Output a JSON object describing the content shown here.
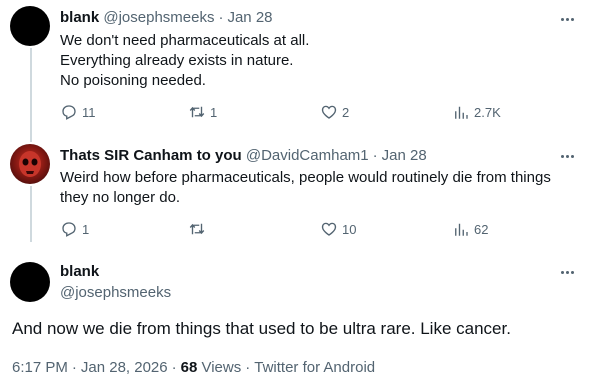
{
  "tweets": [
    {
      "name": "blank",
      "handle": "@josephsmeeks",
      "date": "Jan 28",
      "lines": [
        "We don't need pharmaceuticals at all.",
        "Everything already exists in nature.",
        "No poisoning needed."
      ],
      "replies": "11",
      "retweets": "1",
      "likes": "2",
      "views": "2.7K"
    },
    {
      "name": "Thats SIR Canham to you",
      "handle": "@DavidCamham1",
      "date": "Jan 28",
      "lines": [
        "Weird how before pharmaceuticals, people would routinely die from things",
        "they no longer do."
      ],
      "replies": "1",
      "retweets": "",
      "likes": "10",
      "views": "62"
    }
  ],
  "focused": {
    "name": "blank",
    "handle": "@josephsmeeks",
    "text": "And now we die from things that used to be ultra rare. Like cancer.",
    "time": "6:17 PM",
    "date": "Jan 28, 2026",
    "views_count": "68",
    "views_label": "Views",
    "source": "Twitter for Android"
  },
  "separator": "·",
  "colors": {
    "text": "#0f1419",
    "secondary": "#536471",
    "thread_line": "#cfd9de"
  },
  "icons": [
    "reply-icon",
    "retweet-icon",
    "like-icon",
    "views-icon",
    "more-icon"
  ]
}
